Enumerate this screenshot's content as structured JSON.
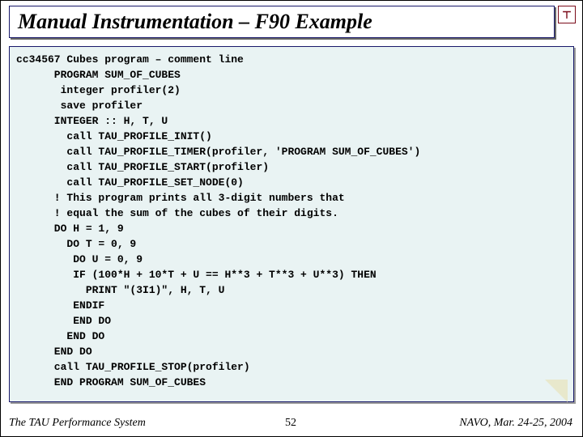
{
  "title": "Manual Instrumentation – F90 Example",
  "logo": "tau-logo",
  "code": "cc34567 Cubes program – comment line\n      PROGRAM SUM_OF_CUBES\n       integer profiler(2)\n       save profiler\n      INTEGER :: H, T, U\n        call TAU_PROFILE_INIT()\n        call TAU_PROFILE_TIMER(profiler, 'PROGRAM SUM_OF_CUBES')\n        call TAU_PROFILE_START(profiler)\n        call TAU_PROFILE_SET_NODE(0)\n      ! This program prints all 3-digit numbers that\n      ! equal the sum of the cubes of their digits.\n      DO H = 1, 9\n        DO T = 0, 9\n         DO U = 0, 9\n         IF (100*H + 10*T + U == H**3 + T**3 + U**3) THEN\n           PRINT \"(3I1)\", H, T, U\n         ENDIF\n         END DO\n        END DO\n      END DO\n      call TAU_PROFILE_STOP(profiler)\n      END PROGRAM SUM_OF_CUBES",
  "footer": {
    "left": "The TAU Performance System",
    "center": "52",
    "right": "NAVO, Mar. 24-25, 2004"
  }
}
